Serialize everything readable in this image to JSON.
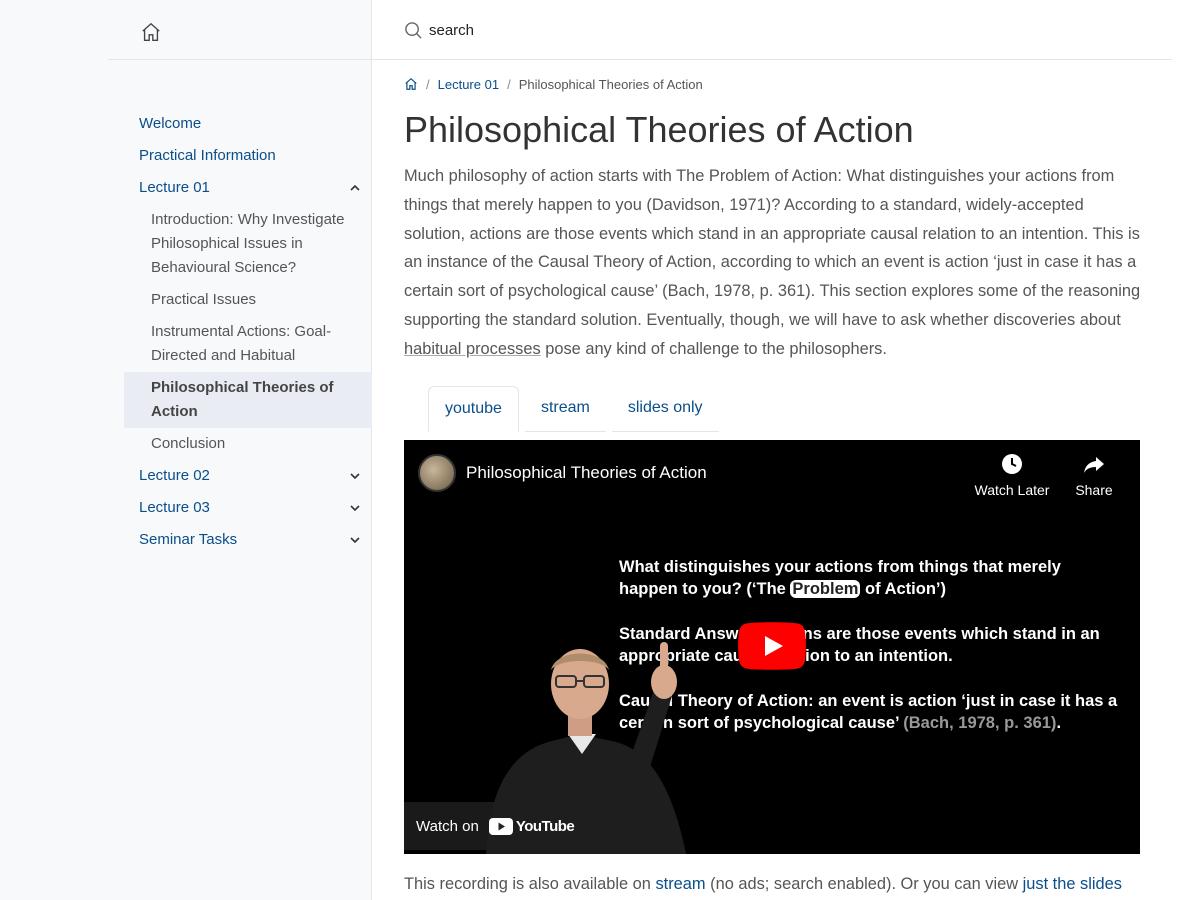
{
  "search": {
    "placeholder": "search"
  },
  "sidebar": {
    "items": [
      {
        "label": "Welcome"
      },
      {
        "label": "Practical Information"
      },
      {
        "label": "Lecture 01",
        "children": [
          {
            "label": "Introduction: Why Investigate Philosophical Issues in Behavioural Science?"
          },
          {
            "label": "Practical Issues"
          },
          {
            "label": "Instrumental Actions: Goal-Directed and Habitual"
          },
          {
            "label": "Philosophical Theories of Action",
            "active": true
          },
          {
            "label": "Conclusion"
          }
        ]
      },
      {
        "label": "Lecture 02"
      },
      {
        "label": "Lecture 03"
      },
      {
        "label": "Seminar Tasks"
      }
    ]
  },
  "breadcrumb": {
    "link": "Lecture 01",
    "current": "Philosophical Theories of Action"
  },
  "page": {
    "title": "Philosophical Theories of Action",
    "intro_pre": "Much philosophy of action starts with The Problem of Action: What distinguishes your actions from things that merely happen to you (Davidson, 1971)? According to a standard, widely-accepted solution, actions are those events which stand in an appropriate causal relation to an intention. This is an instance of the Causal Theory of Action, according to which an event is action ‘just in case it has a certain sort of psychological cause’ (Bach, 1978, p. 361). This section explores some of the reasoning supporting the standard solution. Eventually, though, we will have to ask whether discoveries about ",
    "intro_link": "habitual processes",
    "intro_post": " pose any kind of challenge to the philosophers."
  },
  "tabs": [
    "youtube",
    "stream",
    "slides only"
  ],
  "video": {
    "title": "Philosophical Theories of Action",
    "watch_later": "Watch Later",
    "share": "Share",
    "watch_on": "Watch on",
    "youtube": "YouTube",
    "slide_line1_a": "What distinguishes your actions from things that merely happen to you? (‘The ",
    "slide_line1_hl": "Problem",
    "slide_line1_b": " of Action’)",
    "slide_line2": "Standard Answer: actions are those events which stand in an appropriate causal relation to an intention.",
    "slide_line3_a": "Causal Theory of Action: an event is action ‘just in case it has a certain sort of psychological cause’ ",
    "slide_line3_ref": "(Bach, 1978, p. 361)",
    "slide_line3_b": "."
  },
  "footer": {
    "pre": "This recording is also available on ",
    "stream_link": "stream",
    "mid": " (no ads; search enabled). Or you can view ",
    "slides_link": "just the slides"
  }
}
